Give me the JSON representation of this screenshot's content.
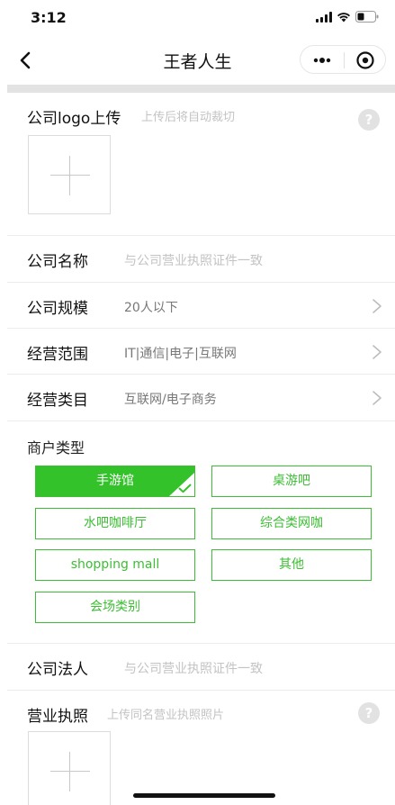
{
  "status_bar": {
    "time": "3:12"
  },
  "nav": {
    "title": "王者人生"
  },
  "logo_upload": {
    "label": "公司logo上传",
    "hint": "上传后将自动裁切",
    "help": "?"
  },
  "company_name": {
    "label": "公司名称",
    "placeholder": "与公司营业执照证件一致"
  },
  "company_scale": {
    "label": "公司规模",
    "value": "20人以下"
  },
  "business_scope": {
    "label": "经营范围",
    "value": "IT|通信|电子|互联网"
  },
  "business_category": {
    "label": "经营类目",
    "value": "互联网/电子商务"
  },
  "merchant_type": {
    "label": "商户类型",
    "options": [
      "手游馆",
      "桌游吧",
      "水吧咖啡厅",
      "综合类网咖",
      "shopping mall",
      "其他",
      "会场类别"
    ],
    "selected": "手游馆"
  },
  "legal_person": {
    "label": "公司法人",
    "placeholder": "与公司营业执照证件一致"
  },
  "license_upload": {
    "label": "营业执照",
    "hint": "上传同名营业执照照片",
    "help": "?"
  },
  "colors": {
    "accent": "#33c22a",
    "border": "#3dbe34",
    "placeholder": "#c3c3c3"
  }
}
